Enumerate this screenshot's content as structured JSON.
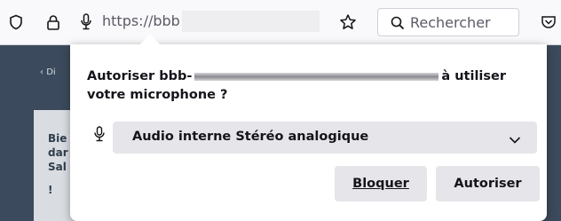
{
  "toolbar": {
    "url": "https://bbb",
    "search_placeholder": "Rechercher"
  },
  "page": {
    "breadcrumb": "Di",
    "card_lines": [
      "Bie",
      "dar",
      "Sal",
      "!"
    ]
  },
  "permission": {
    "message_start": "Autoriser bbb-",
    "message_end": "à utiliser votre microphone ?",
    "device": "Audio interne Stéréo analogique",
    "block_label": "Bloquer",
    "allow_label": "Autoriser"
  },
  "colors": {
    "popup_bg": "#ffffff",
    "button_bg": "#e5e5ea",
    "page_bg": "#3b4a5c"
  }
}
